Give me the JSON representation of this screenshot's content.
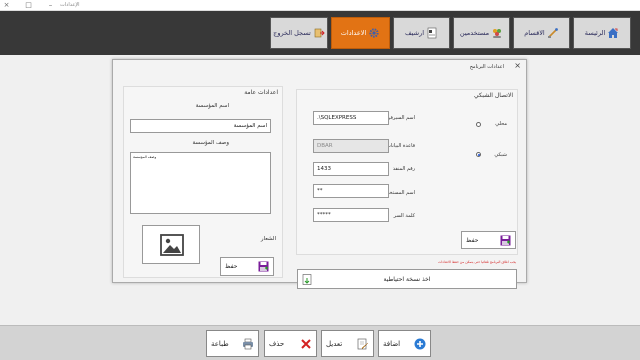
{
  "window": {
    "title": "الإعدادات",
    "controls": {
      "close": "×",
      "restore": "□",
      "minimize": "–"
    }
  },
  "nav": {
    "items": [
      {
        "label": "الرئيسة",
        "icon": "home-icon"
      },
      {
        "label": "الاقسام",
        "icon": "sections-icon"
      },
      {
        "label": "مستخدمين",
        "icon": "users-icon"
      },
      {
        "label": "ارشيف",
        "icon": "archive-icon"
      },
      {
        "label": "الاعدادات",
        "icon": "gear-icon",
        "active": true
      },
      {
        "label": "تسجل الخروج",
        "icon": "logout-icon"
      }
    ]
  },
  "dialog": {
    "title": "اعدادات البرنامج",
    "close": "×",
    "network": {
      "section_title": "الاتصال الشبكي",
      "local_label": "محلي",
      "network_label": "شبكي",
      "selected_mode": "شبكي",
      "server_label": "اسم السيرفر",
      "server_value": ".\\SQLEXPRESS",
      "database_label": "قاعدة البيانات",
      "database_value": "DBAR",
      "port_label": "رقم المنفذ",
      "port_value": "1433",
      "username_label": "اسم المستخدم",
      "username_value": "**",
      "password_label": "كلمة السر",
      "password_value": "*****",
      "save_label": "حفظ"
    },
    "general": {
      "section_title": "اعدادات عامة",
      "org_name_label": "اسم المؤسسة",
      "org_name_value": "اسم المؤسسة",
      "org_desc_label": "وصف المؤسسة",
      "org_desc_value": "وصف المؤسسة",
      "logo_label": "الشعار",
      "save_label": "حفظ"
    },
    "note": "يجب اغلاق البرنامج تلقائيا حتى يتمكن من حفظ الاعدادات",
    "backup_label": "اخذ نسخة احتياطية"
  },
  "toolbar": {
    "add_label": "اضافة",
    "edit_label": "تعديل",
    "delete_label": "حذف",
    "print_label": "طباعة"
  },
  "colors": {
    "header_bg": "#383838",
    "active_tab": "#e27314",
    "save_icon": "#7a1d9a",
    "delete_icon": "#d32222",
    "add_icon": "#2a7bd4"
  }
}
